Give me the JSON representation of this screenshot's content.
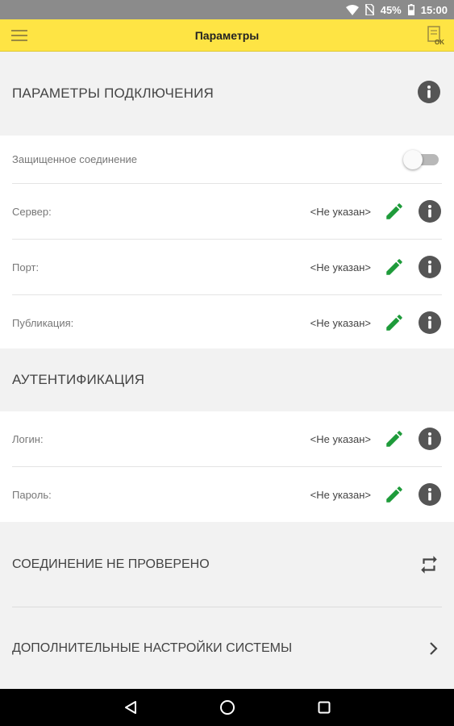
{
  "status_bar": {
    "battery": "45%",
    "time": "15:00"
  },
  "app_bar": {
    "title": "Параметры"
  },
  "connection": {
    "header": "ПАРАМЕТРЫ ПОДКЛЮЧЕНИЯ",
    "secure_label": "Защищенное соединение",
    "secure_enabled": false,
    "fields": [
      {
        "label": "Сервер:",
        "value": "<Не указан>"
      },
      {
        "label": "Порт:",
        "value": "<Не указан>"
      },
      {
        "label": "Публикация:",
        "value": "<Не указан>"
      }
    ]
  },
  "auth": {
    "header": "АУТЕНТИФИКАЦИЯ",
    "fields": [
      {
        "label": "Логин:",
        "value": "<Не указан>"
      },
      {
        "label": "Пароль:",
        "value": "<Не указан>"
      }
    ]
  },
  "actions": {
    "check_connection": "СОЕДИНЕНИЕ НЕ ПРОВЕРЕНО",
    "extra_settings": "ДОПОЛНИТЕЛЬНЫЕ НАСТРОЙКИ СИСТЕМЫ"
  },
  "colors": {
    "accent_yellow": "#fee444",
    "edit_green": "#1e9b3a",
    "info_gray": "#555555"
  },
  "icons": {
    "menu": "menu-icon",
    "ok": "ok-document-icon",
    "info": "info-icon",
    "edit": "pencil-icon",
    "sync": "sync-arrows-icon",
    "chevron": "chevron-right-icon"
  }
}
